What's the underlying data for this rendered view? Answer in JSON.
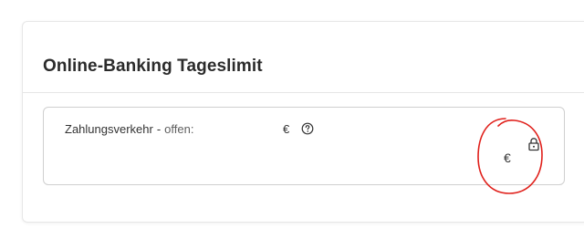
{
  "card": {
    "title": "Online-Banking Tageslimit"
  },
  "limit": {
    "label": "Zahlungsverkehr",
    "separator": "-",
    "status": "offen:",
    "open_currency": "€",
    "limit_currency": "€",
    "help_icon": "question-circle-icon",
    "lock_icon": "lock-icon"
  },
  "colors": {
    "annotation": "#e0201b",
    "border": "#cfcfcf",
    "title": "#2b2b2b"
  }
}
